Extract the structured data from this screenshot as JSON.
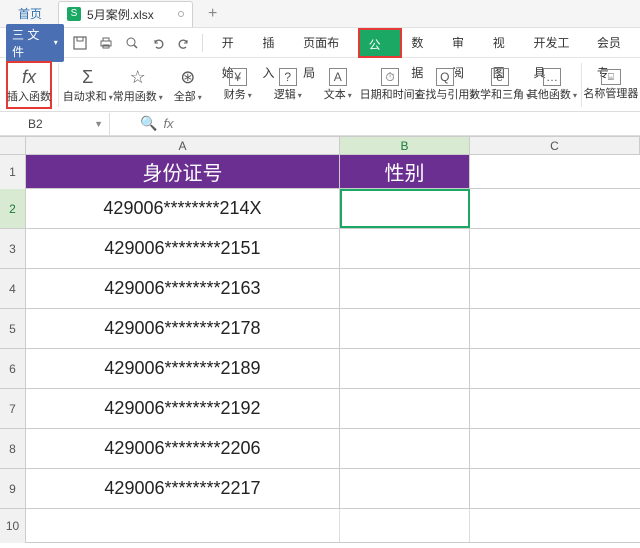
{
  "titlebar": {
    "home": "首页",
    "doc_icon": "S",
    "doc_name": "5月案例.xlsx",
    "plus": "+"
  },
  "menubar": {
    "file": "三 文件",
    "tabs": [
      "开始",
      "插入",
      "页面布局",
      "公式",
      "数据",
      "审阅",
      "视图",
      "开发工具",
      "会员专"
    ],
    "active_idx": 3
  },
  "ribbon": [
    {
      "icon": "fx",
      "label": "插入函数",
      "dd": false
    },
    {
      "icon": "Σ",
      "label": "自动求和",
      "dd": true
    },
    {
      "icon": "☆",
      "label": "常用函数",
      "dd": true
    },
    {
      "icon": "⊛",
      "label": "全部",
      "dd": true
    },
    {
      "icon": "¥",
      "label": "财务",
      "dd": true
    },
    {
      "icon": "?",
      "label": "逻辑",
      "dd": true
    },
    {
      "icon": "A",
      "label": "文本",
      "dd": true
    },
    {
      "icon": "⏱",
      "label": "日期和时间",
      "dd": true
    },
    {
      "icon": "Q",
      "label": "查找与引用",
      "dd": true
    },
    {
      "icon": "e",
      "label": "数学和三角",
      "dd": true
    },
    {
      "icon": "…",
      "label": "其他函数",
      "dd": true
    },
    {
      "icon": "⌸",
      "label": "名称管理器",
      "dd": false
    }
  ],
  "formula_bar": {
    "cellref": "B2",
    "fx": "fx"
  },
  "columns": [
    "A",
    "B",
    "C"
  ],
  "headers": {
    "A": "身份证号",
    "B": "性别"
  },
  "rows": [
    "429006********214X",
    "429006********2151",
    "429006********2163",
    "429006********2178",
    "429006********2189",
    "429006********2192",
    "429006********2206",
    "429006********2217"
  ],
  "selected_cell": "B2"
}
